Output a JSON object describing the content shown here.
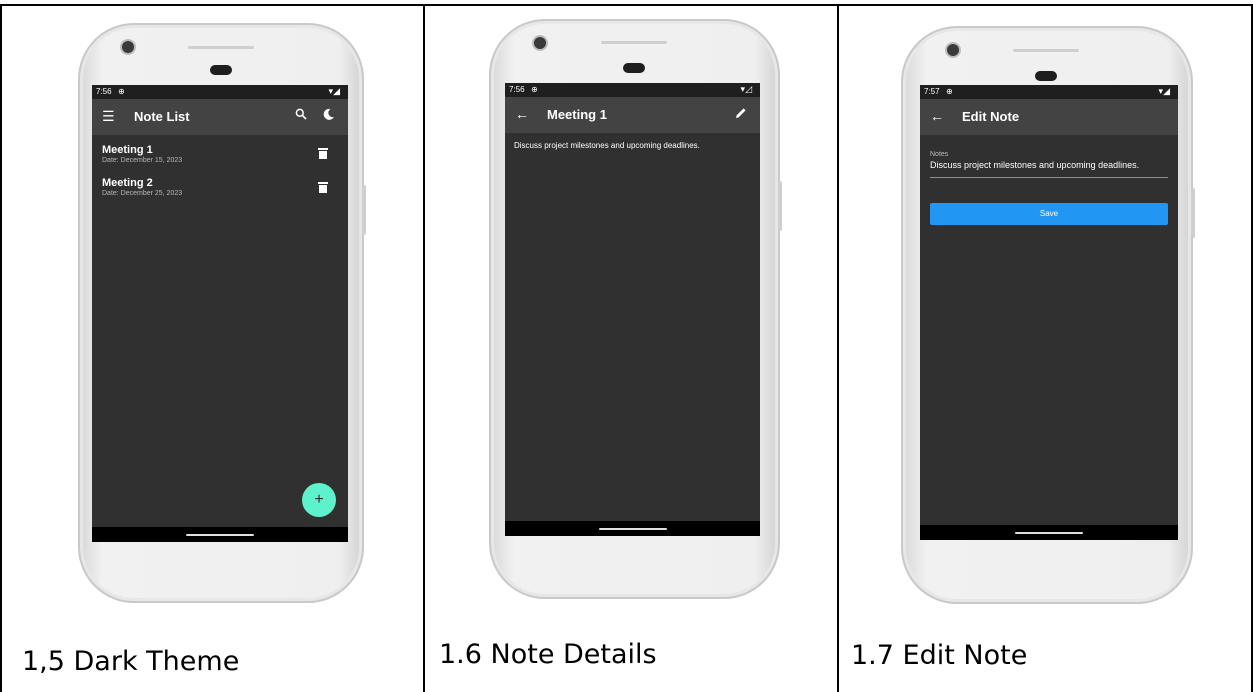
{
  "panels": [
    {
      "caption": "1,5 Dark Theme",
      "status_time": "7:56",
      "appbar_title": "Note List",
      "notes": [
        {
          "title": "Meeting 1",
          "date": "Date: December 15, 2023"
        },
        {
          "title": "Meeting 2",
          "date": "Date: December 25, 2023"
        }
      ],
      "fab_label": "+"
    },
    {
      "caption": "1.6 Note Details",
      "status_time": "7:56",
      "appbar_title": "Meeting 1",
      "body": "Discuss project milestones and upcoming deadlines."
    },
    {
      "caption": "1.7 Edit Note",
      "status_time": "7:57",
      "appbar_title": "Edit Note",
      "field_label": "Notes",
      "field_value": "Discuss project milestones and upcoming deadlines.",
      "save_label": "Save"
    }
  ],
  "colors": {
    "screen_bg": "#303030",
    "appbar_bg": "#434343",
    "fab": "#5ef2cc",
    "save_button": "#2196f3"
  }
}
